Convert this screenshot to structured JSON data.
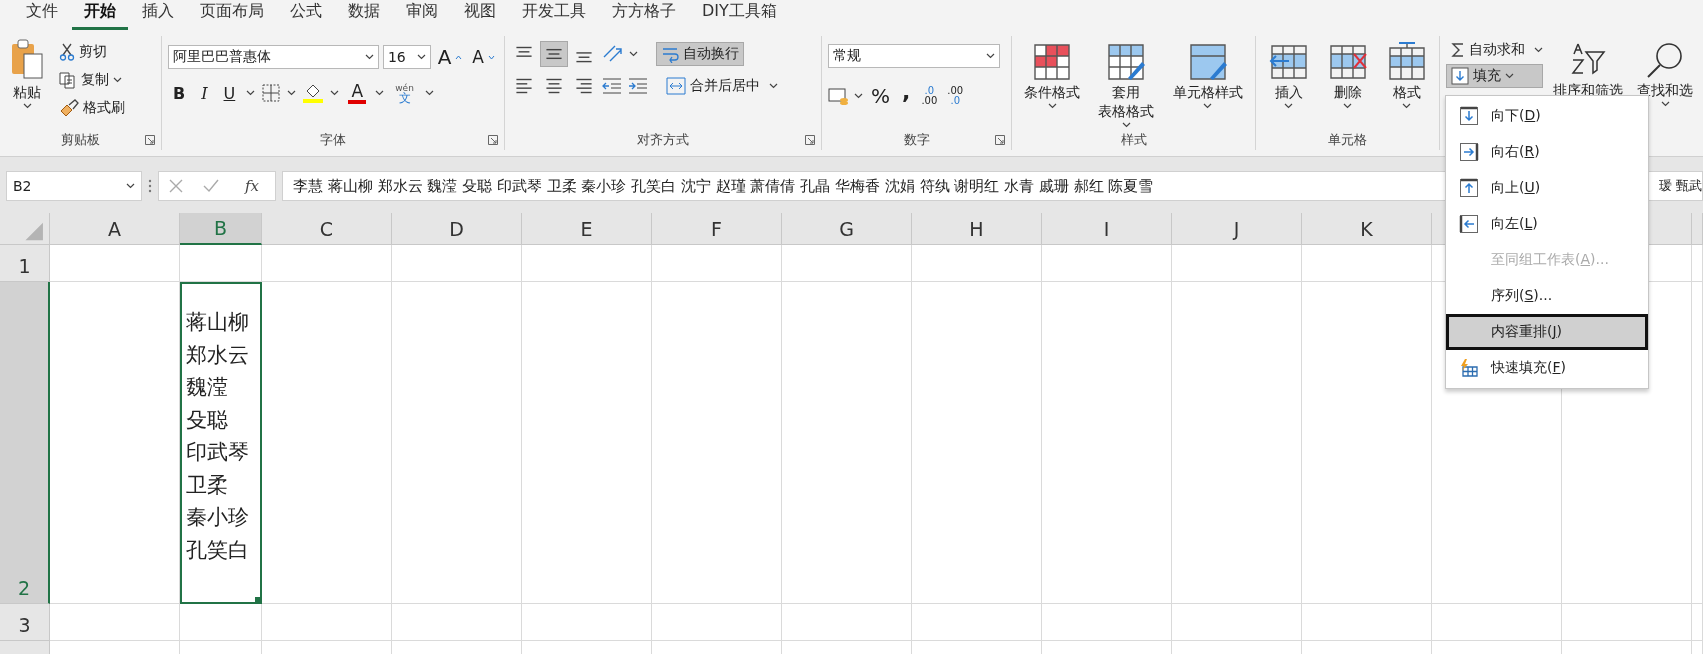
{
  "tabs": [
    {
      "label": "文件",
      "selected": false
    },
    {
      "label": "开始",
      "selected": true
    },
    {
      "label": "插入",
      "selected": false
    },
    {
      "label": "页面布局",
      "selected": false
    },
    {
      "label": "公式",
      "selected": false
    },
    {
      "label": "数据",
      "selected": false
    },
    {
      "label": "审阅",
      "selected": false
    },
    {
      "label": "视图",
      "selected": false
    },
    {
      "label": "开发工具",
      "selected": false
    },
    {
      "label": "方方格子",
      "selected": false
    },
    {
      "label": "DIY工具箱",
      "selected": false
    }
  ],
  "clipboard": {
    "paste": "粘贴",
    "cut": "剪切",
    "copy": "复制",
    "format_painter": "格式刷",
    "label": "剪贴板"
  },
  "font": {
    "name": "阿里巴巴普惠体",
    "size": "16",
    "grow": "A",
    "shrink": "A",
    "bold": "B",
    "italic": "I",
    "underline": "U",
    "phonetic_top": "wén",
    "phonetic_bottom": "文",
    "font_color_letter": "A",
    "label": "字体"
  },
  "alignment": {
    "vertical": [
      {
        "kind": "top",
        "selected": false
      },
      {
        "kind": "middle",
        "selected": true
      },
      {
        "kind": "bottom",
        "selected": false
      }
    ],
    "wrap_text": {
      "label": "自动换行",
      "selected": true
    },
    "merge": "合并后居中",
    "label": "对齐方式"
  },
  "number": {
    "format": "常规",
    "percent": "%",
    "comma": ",",
    "increase_decimal_top": ".0",
    "increase_decimal_bottom": ".00",
    "decrease_decimal_top": ".00",
    "decrease_decimal_bottom": ".0",
    "label": "数字"
  },
  "styles": {
    "items": [
      {
        "kind": "conditional",
        "lines": [
          "条件格式"
        ]
      },
      {
        "kind": "table",
        "lines": [
          "套用",
          "表格格式"
        ]
      },
      {
        "kind": "cell",
        "lines": [
          "单元格样式"
        ]
      }
    ],
    "label": "样式"
  },
  "cells": {
    "items": [
      {
        "kind": "insert",
        "label": "插入"
      },
      {
        "kind": "delete",
        "label": "删除"
      },
      {
        "kind": "format",
        "label": "格式"
      }
    ],
    "label": "单元格"
  },
  "editing": {
    "autosum": "自动求和",
    "fill": {
      "label": "填充",
      "selected": true
    },
    "sort": "排序和筛选",
    "find": "查找和选"
  },
  "formula_bar": {
    "name_box": "B2",
    "fx": "fx",
    "value": "李慧 蒋山柳 郑水云 魏滢 殳聪 印武琴 卫柔 秦小珍 孔笑白 沈宁 赵瑾 萧倩倩 孔晶 华梅香 沈娟 符纨 谢明红 水青 戚珊 郝红 陈夏雪",
    "value_tail": "瑗 甄武"
  },
  "sheet": {
    "columns": [
      {
        "label": "A",
        "selected": false
      },
      {
        "label": "B",
        "selected": true
      },
      {
        "label": "C",
        "selected": false
      },
      {
        "label": "D",
        "selected": false
      },
      {
        "label": "E",
        "selected": false
      },
      {
        "label": "F",
        "selected": false
      },
      {
        "label": "G",
        "selected": false
      },
      {
        "label": "H",
        "selected": false
      },
      {
        "label": "I",
        "selected": false
      },
      {
        "label": "J",
        "selected": false
      },
      {
        "label": "K",
        "selected": false
      }
    ],
    "rows": [
      {
        "label": "1",
        "selected": false,
        "tall": false
      },
      {
        "label": "2",
        "selected": true,
        "tall": true
      },
      {
        "label": "3",
        "selected": false,
        "tall": false
      }
    ],
    "active_cell": {
      "lines": [
        "蒋山柳",
        "郑水云",
        "魏滢",
        "殳聪",
        "印武琴",
        "卫柔",
        "秦小珍",
        "孔笑白"
      ]
    }
  },
  "fill_menu": {
    "items": [
      {
        "kind": "down",
        "label": "向下(",
        "key": "D",
        "tail": ")",
        "disabled": false,
        "selected": false
      },
      {
        "kind": "right",
        "label": "向右(",
        "key": "R",
        "tail": ")",
        "disabled": false,
        "selected": false
      },
      {
        "kind": "up",
        "label": "向上(",
        "key": "U",
        "tail": ")",
        "disabled": false,
        "selected": false
      },
      {
        "kind": "left",
        "label": "向左(",
        "key": "L",
        "tail": ")",
        "disabled": false,
        "selected": false
      },
      {
        "kind": "none",
        "label": "至同组工作表(",
        "key": "A",
        "tail": ")...",
        "disabled": true,
        "selected": false
      },
      {
        "kind": "none",
        "label": "序列(",
        "key": "S",
        "tail": ")...",
        "disabled": false,
        "selected": false
      },
      {
        "kind": "none",
        "label": "内容重排(",
        "key": "J",
        "tail": ")",
        "disabled": false,
        "selected": true
      },
      {
        "kind": "flash",
        "label": "快速填充(",
        "key": "F",
        "tail": ")",
        "disabled": false,
        "selected": false
      }
    ]
  }
}
